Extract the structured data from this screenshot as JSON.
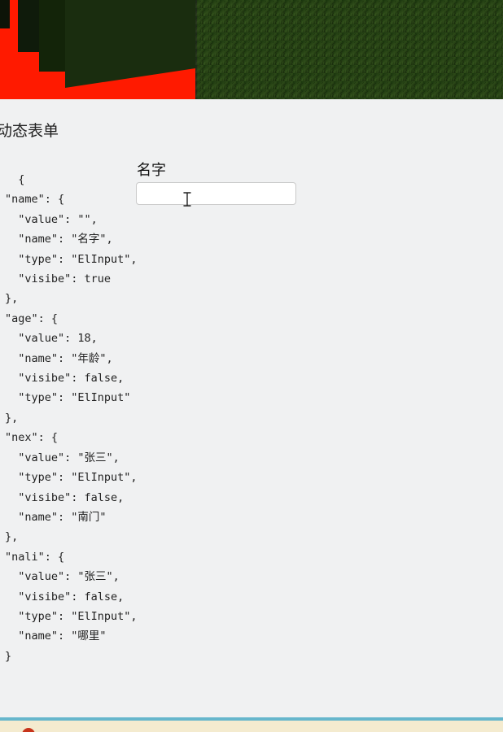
{
  "page": {
    "title": "动态表单"
  },
  "code_preview": {
    "text": "  {\n\"name\": {\n  \"value\": \"\",\n  \"name\": \"名字\",\n  \"type\": \"ElInput\",\n  \"visibe\": true\n},\n\"age\": {\n  \"value\": 18,\n  \"name\": \"年龄\",\n  \"visibe\": false,\n  \"type\": \"ElInput\"\n},\n\"nex\": {\n  \"value\": \"张三\",\n  \"type\": \"ElInput\",\n  \"visibe\": false,\n  \"name\": \"南门\"\n},\n\"nali\": {\n  \"value\": \"张三\",\n  \"visibe\": false,\n  \"type\": \"ElInput\",\n  \"name\": \"哪里\"\n}"
  },
  "form": {
    "field_label": "名字",
    "field_value": ""
  },
  "icons": {
    "cursor": "text-cursor-icon"
  },
  "colors": {
    "hero_red": "#ff1a00",
    "hero_green": "#2d4a18",
    "bottom_bar": "#66b6cc"
  }
}
